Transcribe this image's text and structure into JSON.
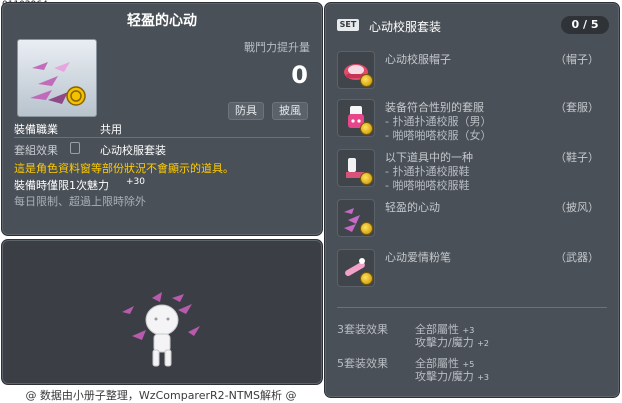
{
  "item_id": "01102964",
  "item": {
    "name": "轻盈的心动",
    "power_label": "戰鬥力提升量",
    "power_value": "0",
    "tags": [
      "防具",
      "披風"
    ],
    "job_label": "裝備職業",
    "job_value": "共用",
    "set_label": "套組效果",
    "set_value": "心动校服套装",
    "warning": "這是角色資料窗等部份狀況不會顯示的道具。",
    "equip_bonus_label": "裝備時僅限1次魅力",
    "equip_bonus_value": "+30",
    "limit_note": "每日限制、超過上限時除外"
  },
  "set": {
    "badge": "SET",
    "title": "心动校服套装",
    "count": "0 / 5",
    "items": [
      {
        "name": "心动校服帽子",
        "category": "（帽子）",
        "subs": []
      },
      {
        "name": "装备符合性别的套服",
        "category": "（套服）",
        "subs": [
          "- 扑通扑通校服（男）",
          "- 啪嗒啪嗒校服（女）"
        ]
      },
      {
        "name": "以下道具中的一种",
        "category": "（鞋子）",
        "subs": [
          "- 扑通扑通校服鞋",
          "- 啪嗒啪嗒校服鞋"
        ]
      },
      {
        "name": "轻盈的心动",
        "category": "（披风）",
        "subs": []
      },
      {
        "name": "心动爱情粉笔",
        "category": "（武器）",
        "subs": []
      }
    ],
    "bonuses": [
      {
        "label": "3套装效果",
        "stat1": "全部屬性",
        "val1": "+3",
        "stat2": "攻擊力/魔力",
        "val2": "+2"
      },
      {
        "label": "5套装效果",
        "stat1": "全部屬性",
        "val1": "+5",
        "stat2": "攻擊力/魔力",
        "val2": "+3"
      }
    ]
  },
  "footer": "@ 数据由小册子整理，WzComparerR2-NTMS解析 @",
  "colors": {
    "panel": "#4a5057",
    "warning": "#ffcc00",
    "accent_pink": "#e070c0"
  }
}
